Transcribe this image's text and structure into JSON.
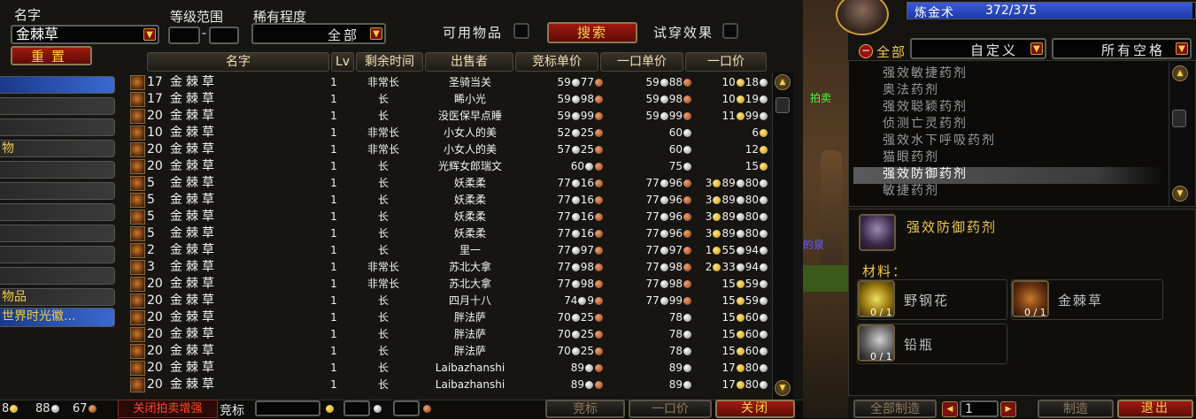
{
  "search": {
    "name_label": "名字",
    "name_value": "金棘草",
    "level_label": "等级范围",
    "level_sep": "-",
    "rarity_label": "稀有程度",
    "rarity_value": "全部",
    "usable_label": "可用物品",
    "search_button": "搜索",
    "tryon_label": "试穿效果",
    "reset_button": "重置"
  },
  "categories": {
    "item_8": "物",
    "item_12": "物品",
    "item_13": "世界时光徽..."
  },
  "columns": {
    "name": "名字",
    "lv": "Lv",
    "time": "剩余时间",
    "seller": "出售者",
    "bid": "竞标单价",
    "unit": "一口单价",
    "buyout": "一口价"
  },
  "auctions": [
    {
      "qty": "17",
      "name": "金棘草",
      "lv": "1",
      "time": "非常长",
      "seller": "圣骑当关",
      "bid_s": "59",
      "bid_c": "77",
      "unit_s": "59",
      "unit_c": "88",
      "buy_g": "10",
      "buy_s": "18"
    },
    {
      "qty": "17",
      "name": "金棘草",
      "lv": "1",
      "time": "长",
      "seller": "睎小光",
      "bid_s": "59",
      "bid_c": "98",
      "unit_s": "59",
      "unit_c": "98",
      "buy_g": "10",
      "buy_s": "19"
    },
    {
      "qty": "20",
      "name": "金棘草",
      "lv": "1",
      "time": "长",
      "seller": "没医保早点睡",
      "bid_s": "59",
      "bid_c": "99",
      "unit_s": "59",
      "unit_c": "99",
      "buy_g": "11",
      "buy_s": "99"
    },
    {
      "qty": "10",
      "name": "金棘草",
      "lv": "1",
      "time": "非常长",
      "seller": "小女人的美",
      "bid_s": "52",
      "bid_c": "25",
      "unit_s": "60",
      "unit_c": "",
      "buy_g": "6",
      "buy_s": ""
    },
    {
      "qty": "20",
      "name": "金棘草",
      "lv": "1",
      "time": "非常长",
      "seller": "小女人的美",
      "bid_s": "57",
      "bid_c": "25",
      "unit_s": "60",
      "unit_c": "",
      "buy_g": "12",
      "buy_s": ""
    },
    {
      "qty": "20",
      "name": "金棘草",
      "lv": "1",
      "time": "长",
      "seller": "光辉女郎瑞文",
      "bid_s": "60",
      "bid_c": "",
      "unit_s": "75",
      "unit_c": "",
      "buy_g": "15",
      "buy_s": ""
    },
    {
      "qty": "5",
      "name": "金棘草",
      "lv": "1",
      "time": "长",
      "seller": "妖柔柔",
      "bid_s": "77",
      "bid_c": "16",
      "unit_s": "77",
      "unit_c": "96",
      "buy_g": "3",
      "buy_s": "89",
      "buy_c": "80"
    },
    {
      "qty": "5",
      "name": "金棘草",
      "lv": "1",
      "time": "长",
      "seller": "妖柔柔",
      "bid_s": "77",
      "bid_c": "16",
      "unit_s": "77",
      "unit_c": "96",
      "buy_g": "3",
      "buy_s": "89",
      "buy_c": "80"
    },
    {
      "qty": "5",
      "name": "金棘草",
      "lv": "1",
      "time": "长",
      "seller": "妖柔柔",
      "bid_s": "77",
      "bid_c": "16",
      "unit_s": "77",
      "unit_c": "96",
      "buy_g": "3",
      "buy_s": "89",
      "buy_c": "80"
    },
    {
      "qty": "5",
      "name": "金棘草",
      "lv": "1",
      "time": "长",
      "seller": "妖柔柔",
      "bid_s": "77",
      "bid_c": "16",
      "unit_s": "77",
      "unit_c": "96",
      "buy_g": "3",
      "buy_s": "89",
      "buy_c": "80"
    },
    {
      "qty": "2",
      "name": "金棘草",
      "lv": "1",
      "time": "长",
      "seller": "里一",
      "bid_s": "77",
      "bid_c": "97",
      "unit_s": "77",
      "unit_c": "97",
      "buy_g": "1",
      "buy_s": "55",
      "buy_c": "94"
    },
    {
      "qty": "3",
      "name": "金棘草",
      "lv": "1",
      "time": "非常长",
      "seller": "苏北大拿",
      "bid_s": "77",
      "bid_c": "98",
      "unit_s": "77",
      "unit_c": "98",
      "buy_g": "2",
      "buy_s": "33",
      "buy_c": "94"
    },
    {
      "qty": "20",
      "name": "金棘草",
      "lv": "1",
      "time": "非常长",
      "seller": "苏北大拿",
      "bid_s": "77",
      "bid_c": "98",
      "unit_s": "77",
      "unit_c": "98",
      "buy_g": "15",
      "buy_s": "59"
    },
    {
      "qty": "20",
      "name": "金棘草",
      "lv": "1",
      "time": "长",
      "seller": "四月十八",
      "bid_s": "74",
      "bid_c": "9",
      "unit_s": "77",
      "unit_c": "99",
      "buy_g": "15",
      "buy_s": "59"
    },
    {
      "qty": "20",
      "name": "金棘草",
      "lv": "1",
      "time": "长",
      "seller": "胖法萨",
      "bid_s": "70",
      "bid_c": "25",
      "unit_s": "78",
      "unit_c": "",
      "buy_g": "15",
      "buy_s": "60"
    },
    {
      "qty": "20",
      "name": "金棘草",
      "lv": "1",
      "time": "长",
      "seller": "胖法萨",
      "bid_s": "70",
      "bid_c": "25",
      "unit_s": "78",
      "unit_c": "",
      "buy_g": "15",
      "buy_s": "60"
    },
    {
      "qty": "20",
      "name": "金棘草",
      "lv": "1",
      "time": "长",
      "seller": "胖法萨",
      "bid_s": "70",
      "bid_c": "25",
      "unit_s": "78",
      "unit_c": "",
      "buy_g": "15",
      "buy_s": "60"
    },
    {
      "qty": "20",
      "name": "金棘草",
      "lv": "1",
      "time": "长",
      "seller": "Laibazhanshi",
      "bid_s": "89",
      "bid_c": "",
      "unit_s": "89",
      "unit_c": "",
      "buy_g": "17",
      "buy_s": "80"
    },
    {
      "qty": "20",
      "name": "金棘草",
      "lv": "1",
      "time": "长",
      "seller": "Laibazhanshi",
      "bid_s": "89",
      "bid_c": "",
      "unit_s": "89",
      "unit_c": "",
      "buy_g": "17",
      "buy_s": "80"
    }
  ],
  "bottom": {
    "money_gold": "8",
    "money_silver": "88",
    "money_copper": "67",
    "close_enhance": "关闭拍卖增强",
    "bid_label": "竞标",
    "bid_button": "竞标",
    "buyout_button": "一口价",
    "close_button": "关闭"
  },
  "scene": {
    "fragment_1": "拍卖",
    "fragment_2": "的泉"
  },
  "profession": {
    "name": "炼金术",
    "skill": "372/375",
    "skill_fraction": 0.992
  },
  "filters": {
    "all": "全部",
    "custom": "自定义",
    "slots": "所有空格"
  },
  "recipes": [
    "强效敏捷药剂",
    "奥法药剂",
    "强效聪颖药剂",
    "侦测亡灵药剂",
    "强效水下呼吸药剂",
    "猫眼药剂",
    "强效防御药剂",
    "敏捷药剂"
  ],
  "selected_recipe": "强效防御药剂",
  "reagents_label": "材料：",
  "reagents": [
    {
      "name": "野钢花",
      "count": "0 / 1"
    },
    {
      "name": "金棘草",
      "count": "0 / 1"
    },
    {
      "name": "铅瓶",
      "count": "0 / 1"
    }
  ],
  "craft": {
    "all_button": "全部制造",
    "count": "1",
    "make_button": "制造",
    "exit_button": "退出"
  },
  "colors": {
    "gold_text": "#f0c94a",
    "button_red": "#8c1408",
    "skill_bar": "#1e3aa8"
  }
}
